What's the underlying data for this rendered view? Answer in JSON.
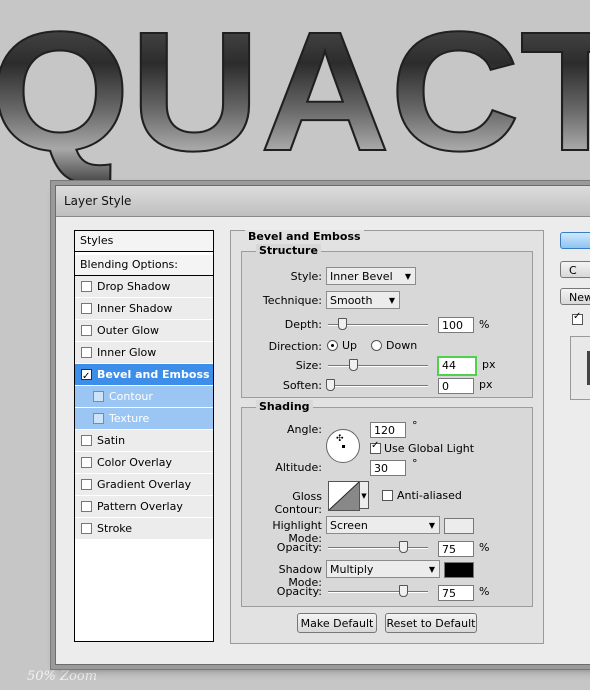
{
  "canvas": {
    "text": "QUACT",
    "zoom": "50% Zoom"
  },
  "dialog": {
    "title": "Layer Style",
    "styles_list": {
      "header": "Styles",
      "blending": "Blending Options: Default",
      "items": [
        {
          "label": "Drop Shadow",
          "checked": false,
          "state": "normal"
        },
        {
          "label": "Inner Shadow",
          "checked": false,
          "state": "normal"
        },
        {
          "label": "Outer Glow",
          "checked": false,
          "state": "normal"
        },
        {
          "label": "Inner Glow",
          "checked": false,
          "state": "normal"
        },
        {
          "label": "Bevel and Emboss",
          "checked": true,
          "state": "active"
        },
        {
          "label": "Contour",
          "checked": false,
          "state": "sub"
        },
        {
          "label": "Texture",
          "checked": false,
          "state": "sub"
        },
        {
          "label": "Satin",
          "checked": false,
          "state": "normal"
        },
        {
          "label": "Color Overlay",
          "checked": false,
          "state": "normal"
        },
        {
          "label": "Gradient Overlay",
          "checked": false,
          "state": "normal"
        },
        {
          "label": "Pattern Overlay",
          "checked": false,
          "state": "normal"
        },
        {
          "label": "Stroke",
          "checked": false,
          "state": "normal"
        }
      ]
    },
    "panel": {
      "title": "Bevel and Emboss",
      "structure": {
        "title": "Structure",
        "style_label": "Style:",
        "style_value": "Inner Bevel",
        "technique_label": "Technique:",
        "technique_value": "Smooth",
        "depth_label": "Depth:",
        "depth_value": "100",
        "depth_unit": "%",
        "direction_label": "Direction:",
        "dir_up": "Up",
        "dir_down": "Down",
        "size_label": "Size:",
        "size_value": "44",
        "size_unit": "px",
        "soften_label": "Soften:",
        "soften_value": "0",
        "soften_unit": "px"
      },
      "shading": {
        "title": "Shading",
        "angle_label": "Angle:",
        "angle_value": "120",
        "angle_unit": "°",
        "global_light": "Use Global Light",
        "altitude_label": "Altitude:",
        "altitude_value": "30",
        "altitude_unit": "°",
        "gloss_label": "Gloss Contour:",
        "anti_aliased": "Anti-aliased",
        "highlight_label": "Highlight Mode:",
        "highlight_value": "Screen",
        "highlight_color": "#ececec",
        "hl_opacity_label": "Opacity:",
        "hl_opacity_value": "75",
        "hl_opacity_unit": "%",
        "shadow_label": "Shadow Mode:",
        "shadow_value": "Multiply",
        "shadow_color": "#000000",
        "sh_opacity_label": "Opacity:",
        "sh_opacity_value": "75",
        "sh_opacity_unit": "%"
      },
      "make_default": "Make Default",
      "reset_default": "Reset to Default"
    },
    "side_buttons": {
      "cancel": "C",
      "new_style": "New"
    }
  }
}
